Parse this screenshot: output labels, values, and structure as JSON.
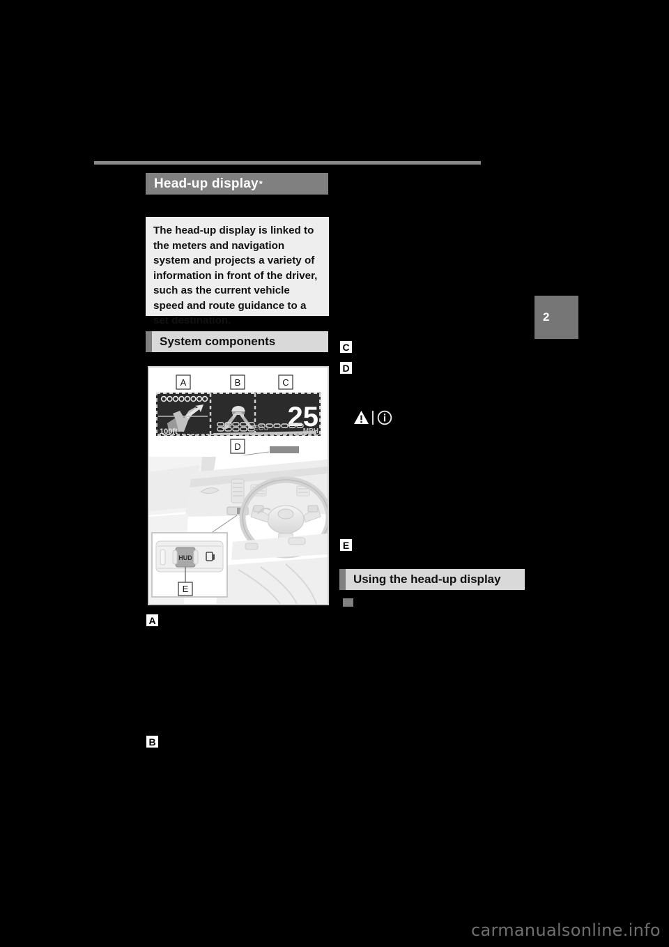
{
  "document": {
    "chapter_tab": "2",
    "watermark": "carmanualsonline.info"
  },
  "section": {
    "title": "Head-up display",
    "title_footnote": "*"
  },
  "intro": {
    "text": "The head-up display is linked to the meters and navigation system and projects a variety of information in front of the driver, such as the current vehicle speed and route guidance to a set destination."
  },
  "headings": {
    "system_components": "System components",
    "using_the_head_up_display": "Using the head-up display"
  },
  "callouts": {
    "a": "A",
    "b": "B",
    "c": "C",
    "d": "D",
    "e": "E"
  },
  "illustration": {
    "hud_top_labels": [
      "A",
      "B",
      "C"
    ],
    "hud_bottom_label": "D",
    "hud_screen": {
      "distance": "100ft",
      "speed_value": "25",
      "speed_unit": "MPH",
      "eco_label": "ECO"
    },
    "button_inset": {
      "hud_button_label": "HUD",
      "callout": "E"
    }
  },
  "notices": {
    "warning_icon": "warning-triangle-icon",
    "info_icon": "info-circle-icon"
  },
  "colors": {
    "title_bar": "#808080",
    "intro_box": "#eeeeee",
    "subhead_bar": "#d9d9d9",
    "subhead_tab": "#808080",
    "rule": "#8a8a8a",
    "page_background": "#000000",
    "watermark": "#6f6f6f"
  }
}
